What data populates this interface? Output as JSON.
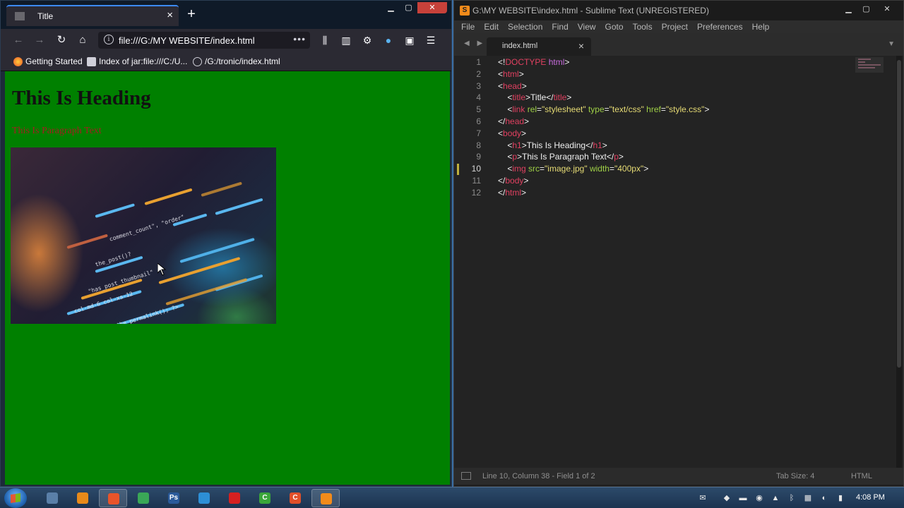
{
  "firefox": {
    "tab_title": "Title",
    "url": "file:///G:/MY WEBSITE/index.html",
    "bookmarks": [
      {
        "label": "Getting Started"
      },
      {
        "label": "Index of jar:file:///C:/U..."
      },
      {
        "label": "/G:/tronic/index.html"
      }
    ],
    "page": {
      "heading": "This Is Heading",
      "paragraph": "This Is Paragraph Text",
      "background_color": "#008000",
      "paragraph_color": "#a02020"
    }
  },
  "sublime": {
    "window_title": "G:\\MY WEBSITE\\index.html - Sublime Text (UNREGISTERED)",
    "menu": [
      "File",
      "Edit",
      "Selection",
      "Find",
      "View",
      "Goto",
      "Tools",
      "Project",
      "Preferences",
      "Help"
    ],
    "tab_name": "index.html",
    "current_line": 10,
    "code_lines": [
      [
        {
          "c": "txt",
          "t": "<!"
        },
        {
          "c": "tag",
          "t": "DOCTYPE"
        },
        {
          "c": "doc",
          "t": " html"
        },
        {
          "c": "txt",
          "t": ">"
        }
      ],
      [
        {
          "c": "txt",
          "t": "<"
        },
        {
          "c": "tag",
          "t": "html"
        },
        {
          "c": "txt",
          "t": ">"
        }
      ],
      [
        {
          "c": "txt",
          "t": "<"
        },
        {
          "c": "tag",
          "t": "head"
        },
        {
          "c": "txt",
          "t": ">"
        }
      ],
      [
        {
          "c": "txt",
          "t": "    <"
        },
        {
          "c": "tag",
          "t": "title"
        },
        {
          "c": "txt",
          "t": ">Title</"
        },
        {
          "c": "tag",
          "t": "title"
        },
        {
          "c": "txt",
          "t": ">"
        }
      ],
      [
        {
          "c": "txt",
          "t": "    <"
        },
        {
          "c": "tag",
          "t": "link"
        },
        {
          "c": "attr",
          "t": " rel"
        },
        {
          "c": "txt",
          "t": "="
        },
        {
          "c": "str",
          "t": "\"stylesheet\""
        },
        {
          "c": "attr",
          "t": " type"
        },
        {
          "c": "txt",
          "t": "="
        },
        {
          "c": "str",
          "t": "\"text/css\""
        },
        {
          "c": "attr",
          "t": " href"
        },
        {
          "c": "txt",
          "t": "="
        },
        {
          "c": "str",
          "t": "\"style.css\""
        },
        {
          "c": "txt",
          "t": ">"
        }
      ],
      [
        {
          "c": "txt",
          "t": "</"
        },
        {
          "c": "tag",
          "t": "head"
        },
        {
          "c": "txt",
          "t": ">"
        }
      ],
      [
        {
          "c": "txt",
          "t": "<"
        },
        {
          "c": "tag",
          "t": "body"
        },
        {
          "c": "txt",
          "t": ">"
        }
      ],
      [
        {
          "c": "txt",
          "t": "    <"
        },
        {
          "c": "tag",
          "t": "h1"
        },
        {
          "c": "txt",
          "t": ">This Is Heading</"
        },
        {
          "c": "tag",
          "t": "h1"
        },
        {
          "c": "txt",
          "t": ">"
        }
      ],
      [
        {
          "c": "txt",
          "t": "    <"
        },
        {
          "c": "tag",
          "t": "p"
        },
        {
          "c": "txt",
          "t": ">This Is Paragraph Text</"
        },
        {
          "c": "tag",
          "t": "p"
        },
        {
          "c": "txt",
          "t": ">"
        }
      ],
      [
        {
          "c": "txt",
          "t": "    <"
        },
        {
          "c": "tag",
          "t": "img"
        },
        {
          "c": "attr",
          "t": " src"
        },
        {
          "c": "txt",
          "t": "="
        },
        {
          "c": "str",
          "t": "\"image.jpg\""
        },
        {
          "c": "attr",
          "t": " width"
        },
        {
          "c": "txt",
          "t": "="
        },
        {
          "c": "str",
          "t": "\"400px\""
        },
        {
          "c": "txt",
          "t": ">"
        }
      ],
      [
        {
          "c": "txt",
          "t": "</"
        },
        {
          "c": "tag",
          "t": "body"
        },
        {
          "c": "txt",
          "t": ">"
        }
      ],
      [
        {
          "c": "txt",
          "t": "</"
        },
        {
          "c": "tag",
          "t": "html"
        },
        {
          "c": "txt",
          "t": ">"
        }
      ]
    ],
    "status": {
      "position": "Line 10, Column 38 - Field 1 of 2",
      "tab_size": "Tab Size: 4",
      "syntax": "HTML"
    }
  },
  "taskbar": {
    "apps": [
      {
        "name": "file-explorer",
        "color": "#5a7fa8"
      },
      {
        "name": "media-player",
        "color": "#e88a1a"
      },
      {
        "name": "firefox",
        "color": "#e8542a",
        "active": true
      },
      {
        "name": "chrome",
        "color": "#3aa757"
      },
      {
        "name": "photoshop",
        "color": "#2a5a9a",
        "label": "Ps"
      },
      {
        "name": "edge",
        "color": "#2d8fd6"
      },
      {
        "name": "opera",
        "color": "#d62020"
      },
      {
        "name": "camtasia-green",
        "color": "#3aa63a",
        "label": "C"
      },
      {
        "name": "camtasia-orange",
        "color": "#e0502a",
        "label": "C"
      },
      {
        "name": "sublime-text",
        "color": "#f38b1a",
        "active": true
      }
    ],
    "clock": "4:08 PM"
  }
}
